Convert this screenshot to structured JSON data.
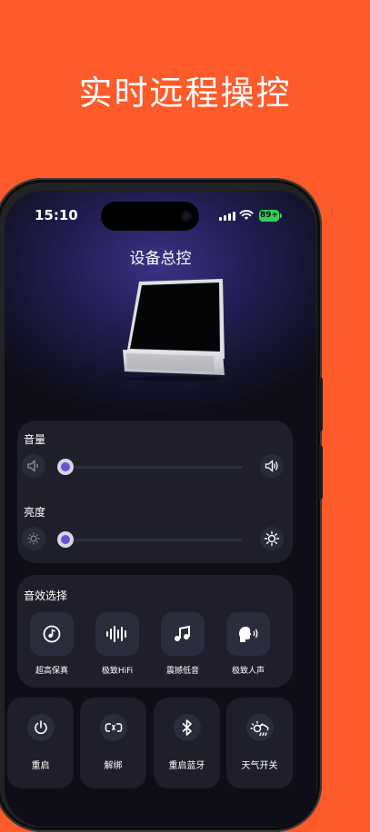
{
  "headline": "实时远程操控",
  "status_bar": {
    "time": "15:10",
    "battery": "89+"
  },
  "screen_title": "设备总控",
  "volume": {
    "label": "音量",
    "level": 0.0,
    "low_icon": "speaker-low-icon",
    "high_icon": "speaker-high-icon"
  },
  "brightness": {
    "label": "亮度",
    "level": 0.0,
    "low_icon": "sun-dim-icon",
    "high_icon": "sun-bright-icon"
  },
  "sound_effects": {
    "label": "音效选择",
    "options": [
      {
        "label": "超高保真",
        "icon": "music-disc-icon"
      },
      {
        "label": "极致HiFi",
        "icon": "waveform-icon"
      },
      {
        "label": "震撼低音",
        "icon": "music-note-icon"
      },
      {
        "label": "极致人声",
        "icon": "voice-head-icon"
      }
    ]
  },
  "controls": [
    {
      "label": "重启",
      "icon": "power-icon"
    },
    {
      "label": "解绑",
      "icon": "unlink-icon"
    },
    {
      "label": "重启蓝牙",
      "icon": "bluetooth-icon"
    },
    {
      "label": "天气开关",
      "icon": "weather-icon"
    }
  ],
  "colors": {
    "background": "#FF5A2A",
    "accent": "#6B4FD8",
    "card": "#1E1F2B",
    "battery": "#31D158"
  }
}
